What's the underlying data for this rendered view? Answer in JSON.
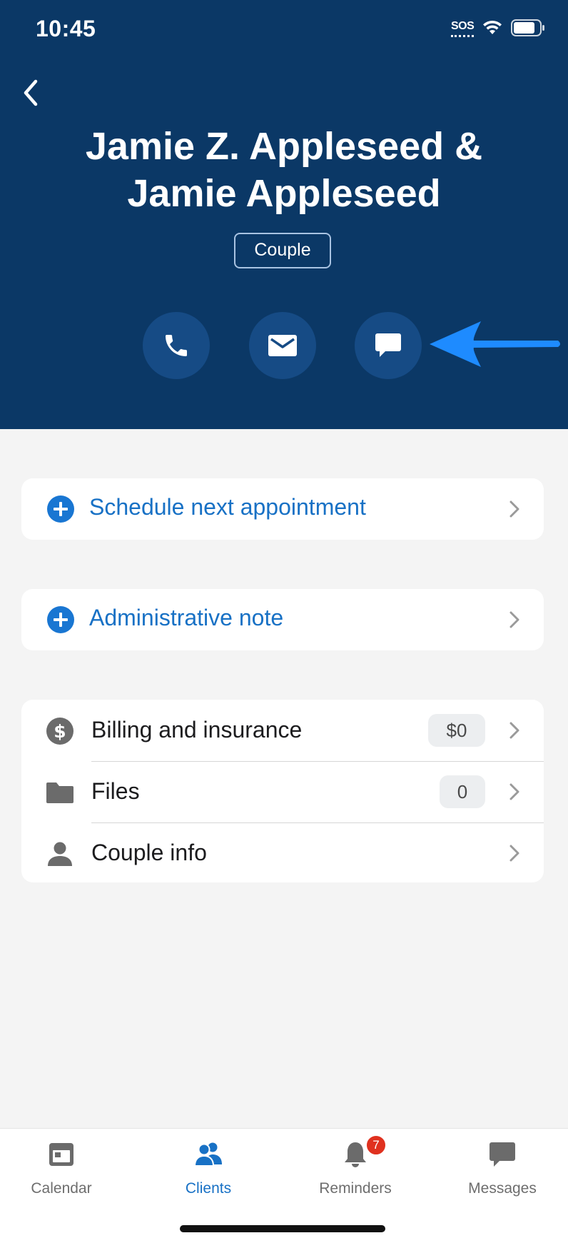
{
  "status_bar": {
    "time": "10:45",
    "sos": "SOS"
  },
  "header": {
    "name_line1": "Jamie Z. Appleseed &",
    "name_line2": "Jamie Appleseed",
    "client_type": "Couple"
  },
  "actions": [
    {
      "icon": "phone-icon"
    },
    {
      "icon": "mail-icon"
    },
    {
      "icon": "chat-icon"
    }
  ],
  "links": {
    "schedule": "Schedule next appointment",
    "admin_note": "Administrative note"
  },
  "details": [
    {
      "icon": "dollar-icon",
      "label": "Billing and insurance",
      "badge": "$0"
    },
    {
      "icon": "folder-icon",
      "label": "Files",
      "badge": "0"
    },
    {
      "icon": "person-icon",
      "label": "Couple info"
    }
  ],
  "tabs": [
    {
      "label": "Calendar",
      "icon": "calendar-icon",
      "active": false
    },
    {
      "label": "Clients",
      "icon": "clients-icon",
      "active": true
    },
    {
      "label": "Reminders",
      "icon": "bell-icon",
      "badge": "7",
      "active": false
    },
    {
      "label": "Messages",
      "icon": "message-icon",
      "active": false
    }
  ],
  "colors": {
    "header_bg": "#0b3866",
    "accent": "#1871c5",
    "annotation_arrow": "#1e8bff",
    "badge_red": "#e0311f"
  }
}
